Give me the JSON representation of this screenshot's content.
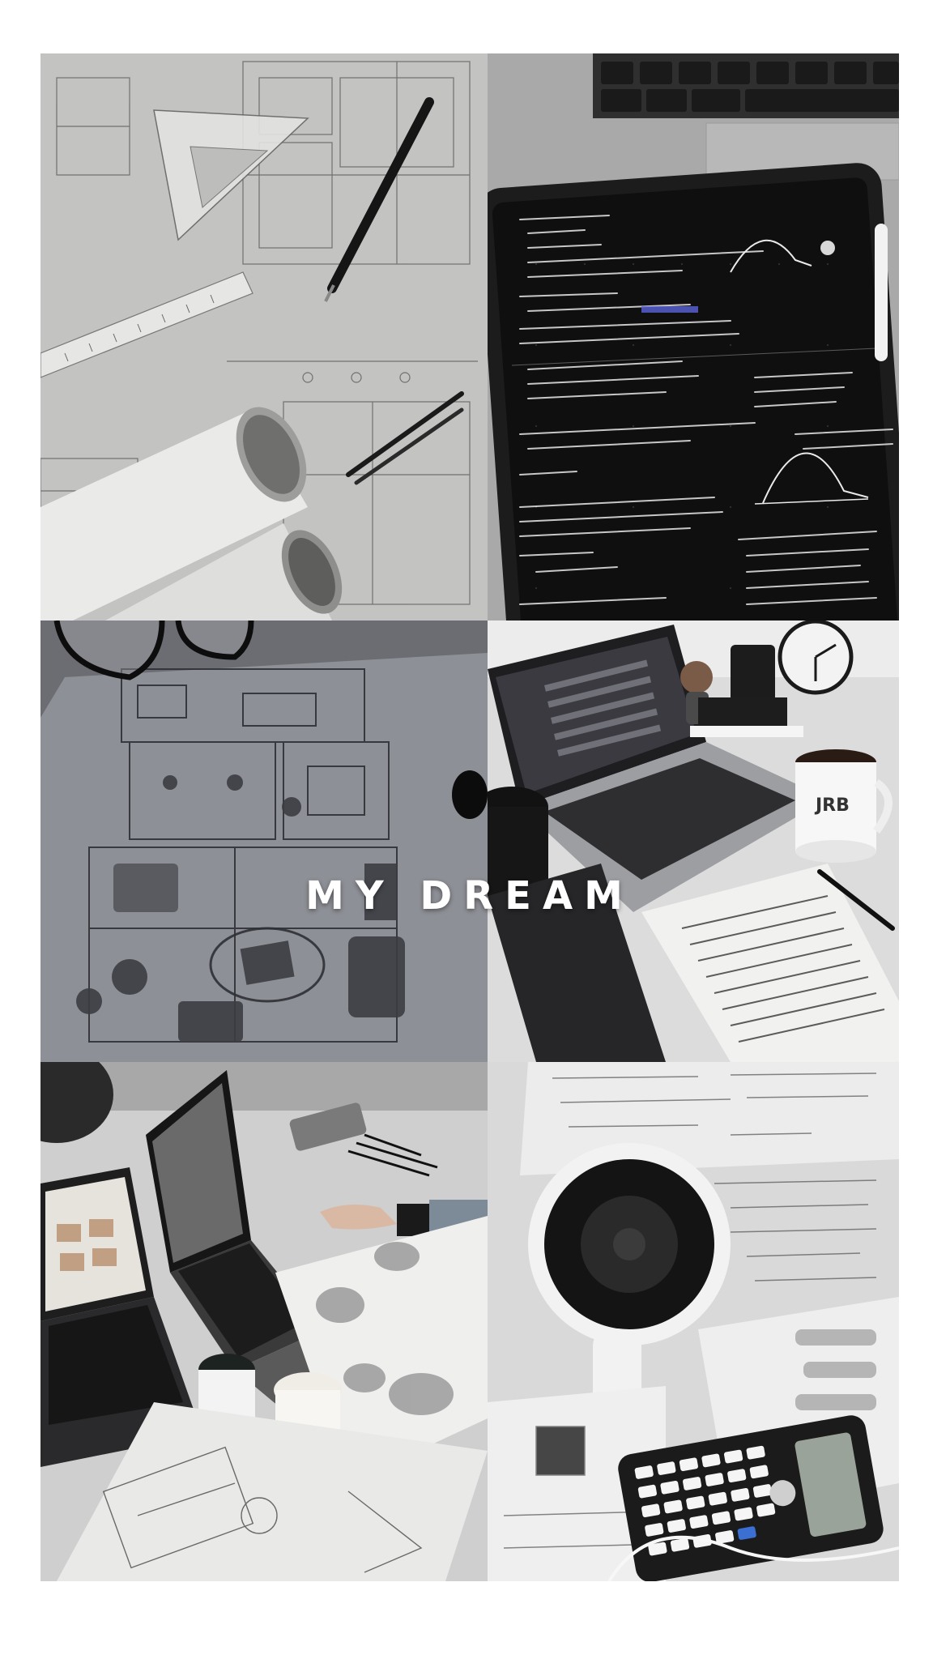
{
  "title": "MY DREAM",
  "colors": {
    "background": "#ffffff",
    "title": "#ffffff"
  },
  "tiles": [
    {
      "subject": "architectural-blueprints-with-ruler-pen-compass-and-rolls"
    },
    {
      "subject": "tablet-with-handwritten-statistics-notes"
    },
    {
      "subject": "hand-drawn-floor-plan-with-glasses"
    },
    {
      "subject": "desk-with-laptop-coffee-mug-and-notebook"
    },
    {
      "subject": "laptops-and-sketchbooks-with-coffee-cups"
    },
    {
      "subject": "coffee-cup-with-calculator-on-math-papers"
    }
  ]
}
